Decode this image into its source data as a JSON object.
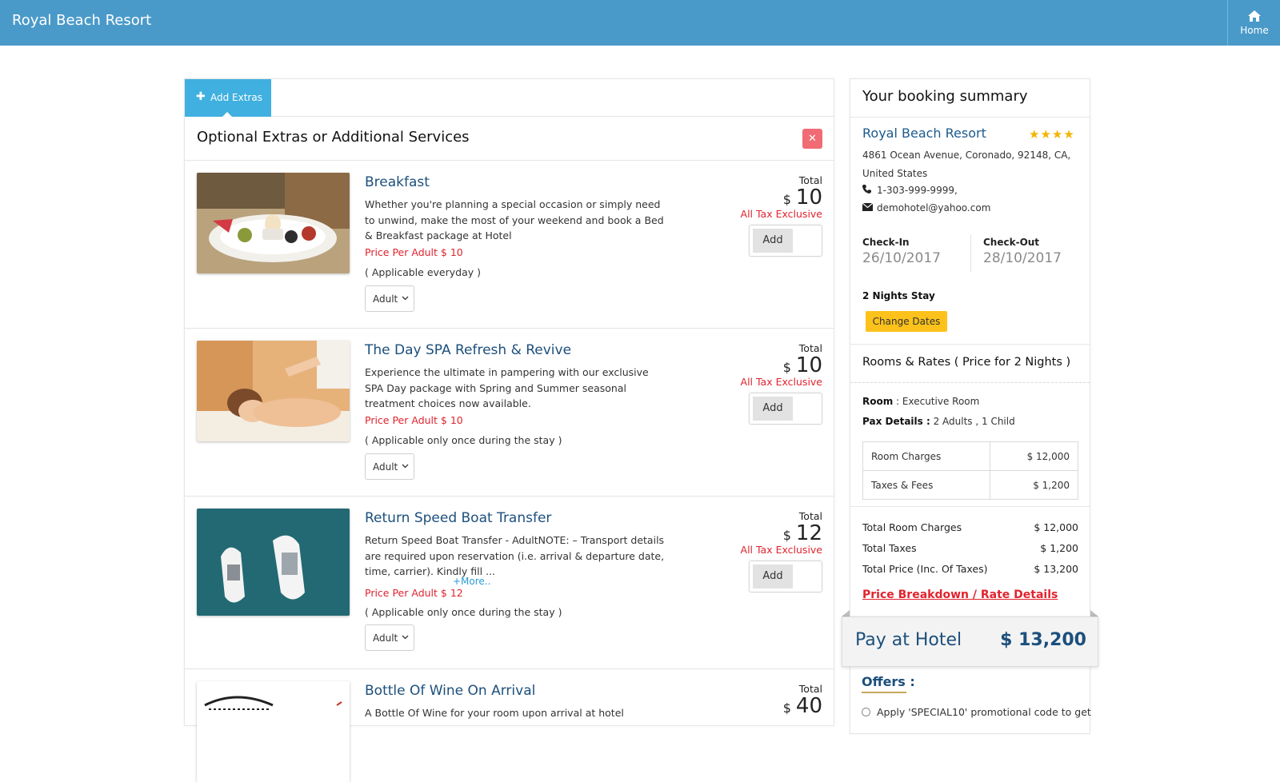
{
  "header": {
    "brand": "Royal Beach Resort",
    "home_label": "Home"
  },
  "extras": {
    "tab_label": "Add Extras",
    "title": "Optional Extras or Additional Services",
    "total_label": "Total",
    "currency": "$",
    "tax_note": "All Tax Exclusive",
    "add_label": "Add",
    "items": [
      {
        "title": "Breakfast",
        "desc": "Whether you're planning a special occasion or simply need to unwind, make the most of your weekend and book a Bed & Breakfast package at Hotel",
        "more": "",
        "price": "Price Per Adult $ 10",
        "applicable": "( Applicable everyday )",
        "select": "Adult",
        "total": "10"
      },
      {
        "title": "The Day SPA Refresh & Revive",
        "desc": "Experience the ultimate in pampering with our exclusive SPA Day package with Spring and Summer seasonal treatment choices now available.",
        "more": "",
        "price": "Price Per Adult $ 10",
        "applicable": "( Applicable only once during the stay )",
        "select": "Adult",
        "total": "10"
      },
      {
        "title": "Return Speed Boat Transfer",
        "desc": "Return Speed Boat Transfer - AdultNOTE: – Transport details are required upon reservation (i.e. arrival & departure date, time, carrier). Kindly fill ...",
        "more": "+More..",
        "price": "Price Per Adult $ 12",
        "applicable": "( Applicable only once during the stay )",
        "select": "Adult",
        "total": "12"
      },
      {
        "title": "Bottle Of Wine On Arrival",
        "desc": "A Bottle Of Wine for your room upon arrival at hotel",
        "more": "",
        "price": "",
        "applicable": "",
        "select": "",
        "total": "40"
      }
    ]
  },
  "summary": {
    "title": "Your booking summary",
    "hotel": "Royal Beach Resort",
    "stars": "★★★★",
    "address": "4861 Ocean Avenue, Coronado, 92148, CA, United States",
    "phone": "1-303-999-9999,",
    "email": "demohotel@yahoo.com",
    "checkin_label": "Check-In",
    "checkin": "26/10/2017",
    "checkout_label": "Check-Out",
    "checkout": "28/10/2017",
    "nights": "2 Nights Stay",
    "change_dates": "Change Dates",
    "rooms_title": "Rooms & Rates ( Price for 2 Nights )",
    "room_label": "Room",
    "room_value": " : Executive Room",
    "pax_label": "Pax Details :",
    "pax_value": " 2 Adults , 1 Child",
    "charges": [
      {
        "label": "Room Charges",
        "value": "$ 12,000"
      },
      {
        "label": "Taxes & Fees",
        "value": "$ 1,200"
      }
    ],
    "totals": [
      {
        "label": "Total Room Charges",
        "value": "$ 12,000"
      },
      {
        "label": "Total Taxes",
        "value": "$ 1,200"
      },
      {
        "label": "Total Price (Inc. Of Taxes)",
        "value": "$ 13,200"
      }
    ],
    "breakdown": "Price Breakdown / Rate Details",
    "pay_label": "Pay at Hotel",
    "pay_value": "$ 13,200",
    "offers_title": "Offers :",
    "offer_text": "Apply 'SPECIAL10' promotional code to get"
  },
  "colors": {
    "topbar": "#4a9ac9",
    "tab": "#3fb0e0",
    "price_red": "#e0232e",
    "title_blue": "#1c4f7c",
    "button_yellow": "#fcc21b"
  },
  "icons": {
    "home": "home-icon",
    "plus": "plus-icon",
    "close": "close-icon",
    "phone": "phone-icon",
    "email": "envelope-icon",
    "star": "star-icon"
  }
}
